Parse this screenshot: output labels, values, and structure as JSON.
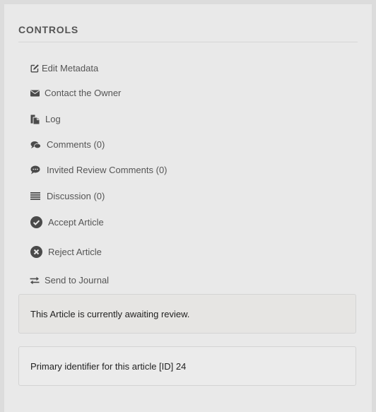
{
  "panel": {
    "title": "CONTROLS"
  },
  "controls": [
    {
      "label": "Edit Metadata",
      "icon": "edit-icon"
    },
    {
      "label": "Contact the Owner",
      "icon": "envelope-icon"
    },
    {
      "label": "Log",
      "icon": "files-icon"
    },
    {
      "label": "Comments (0)",
      "icon": "comments-icon"
    },
    {
      "label": "Invited Review Comments (0)",
      "icon": "comment-dots-icon"
    },
    {
      "label": "Discussion (0)",
      "icon": "list-icon"
    },
    {
      "label": "Accept Article",
      "icon": "check-circle-icon"
    },
    {
      "label": "Reject Article",
      "icon": "times-circle-icon"
    },
    {
      "label": "Send to Journal",
      "icon": "exchange-icon"
    }
  ],
  "status": {
    "notice": "This Article is currently awaiting review.",
    "identifier": "Primary identifier for this article [ID] 24"
  }
}
